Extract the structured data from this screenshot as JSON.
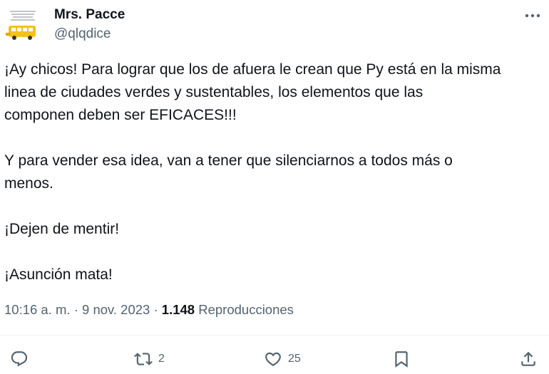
{
  "user": {
    "display_name": "Mrs. Pacce",
    "handle": "@qlqdice",
    "avatar_icon": "avatar-logo-bus",
    "avatar_text": "Si vacaste tus bodegas... EL BUS NORMAL"
  },
  "tweet": {
    "paragraphs": [
      "¡Ay chicos! Para lograr que los de afuera le crean que Py está en la misma\nlinea de ciudades verdes y sustentables, los elementos que las\ncomponen deben ser EFICACES!!!",
      "Y para vender esa idea, van a tener que silenciarnos a todos más o\nmenos.",
      "¡Dejen de mentir!",
      "¡Asunción mata!"
    ]
  },
  "meta": {
    "time": "10:16 a. m.",
    "separator1": " · ",
    "date": "9 nov. 2023",
    "separator2": " · ",
    "views_count": "1.148",
    "views_label": " Reproducciones"
  },
  "actions": {
    "reply_icon": "reply-icon",
    "repost_icon": "repost-icon",
    "repost_count": "2",
    "like_icon": "heart-icon",
    "like_count": "25",
    "bookmark_icon": "bookmark-icon",
    "share_icon": "share-icon"
  },
  "colors": {
    "text_primary": "#0f1419",
    "text_secondary": "#536471",
    "divider": "#eff3f4",
    "avatar_yellow": "#f2c21b"
  }
}
